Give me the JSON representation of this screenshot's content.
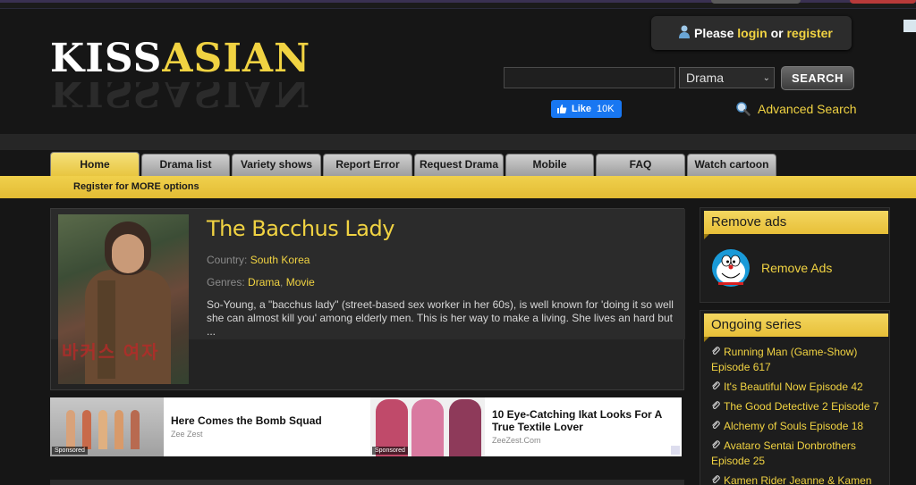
{
  "header": {
    "logo": {
      "text_white": "KISS",
      "text_yellow": "ASIAN"
    },
    "login": {
      "please": "Please",
      "login": "login",
      "or": "or",
      "register": "register"
    },
    "search": {
      "input_value": "",
      "select_value": "Drama",
      "button_label": "SEARCH"
    },
    "fb": {
      "like_label": "Like",
      "count": "10K"
    },
    "advanced_search": "Advanced Search"
  },
  "nav": {
    "tabs": [
      {
        "label": "Home",
        "active": true
      },
      {
        "label": "Drama list"
      },
      {
        "label": "Variety shows"
      },
      {
        "label": "Report Error"
      },
      {
        "label": "Request Drama"
      },
      {
        "label": "Mobile"
      },
      {
        "label": "FAQ"
      },
      {
        "label": "Watch cartoon"
      }
    ],
    "sub_text": "Register for MORE options"
  },
  "main": {
    "title": "The Bacchus Lady",
    "country_label": "Country:",
    "country_value": "South Korea",
    "genres_label": "Genres:",
    "genre_1": "Drama",
    "genre_sep": ",",
    "genre_2": "Movie",
    "description": "So-Young, a \"bacchus lady\" (street-based sex worker in her 60s), is well known for 'doing it so well she can almost kill you' among elderly men. This is her way to make a living. She lives an hard but ..."
  },
  "ads": [
    {
      "title": "Here Comes the Bomb Squad",
      "source": "Zee Zest",
      "sponsored": "Sponsored"
    },
    {
      "title": "10 Eye-Catching Ikat Looks For A True Textile Lover",
      "source": "ZeeZest.Com",
      "sponsored": "Sponsored"
    }
  ],
  "sidebar": {
    "remove_ads": {
      "heading": "Remove ads",
      "label": "Remove Ads"
    },
    "ongoing": {
      "heading": "Ongoing series",
      "items": [
        "Running Man (Game-Show) Episode 617",
        "It's Beautiful Now Episode 42",
        "The Good Detective 2 Episode 7",
        "Alchemy of Souls Episode 18",
        "Avataro Sentai Donbrothers Episode 25",
        "Kamen Rider Jeanne & Kamen"
      ]
    }
  },
  "colors": {
    "accent": "#f1d342",
    "background": "#161616",
    "tab": "#b8b8b8",
    "fb": "#1877f2"
  }
}
